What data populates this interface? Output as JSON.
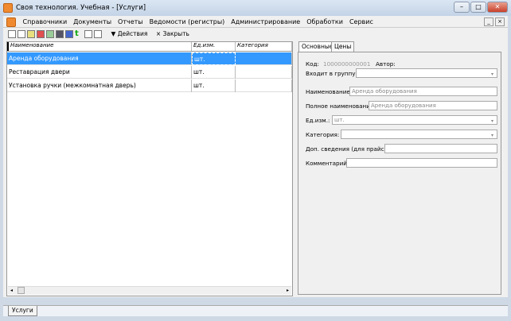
{
  "window": {
    "title": "Своя технология. Учебная - [Услуги]",
    "minimize": "–",
    "maximize": "□",
    "close": "✕"
  },
  "menu": [
    "Справочники",
    "Документы",
    "Отчеты",
    "Ведомости (регистры)",
    "Администрирование",
    "Обработки",
    "Сервис"
  ],
  "toolbar": {
    "actions_label": "▼ Действия",
    "close_label": "× Закрыть"
  },
  "table": {
    "columns": [
      "Наименование",
      "Ед.изм.",
      "Категория"
    ],
    "rows": [
      {
        "name": "Аренда оборудования",
        "unit": "шт.",
        "category": "",
        "selected": true
      },
      {
        "name": "Реставрация двери",
        "unit": "шт.",
        "category": ""
      },
      {
        "name": "Установка ручки (межкомнатная дверь)",
        "unit": "шт.",
        "category": ""
      }
    ]
  },
  "form": {
    "tabs": [
      "Основные",
      "Цены"
    ],
    "code_label": "Код:",
    "code_value": "1000000000001",
    "author_label": "Автор:",
    "group_label": "Входит в группу:",
    "group_value": "",
    "name_label": "Наименование:",
    "name_value": "Аренда оборудования",
    "fullname_label": "Полное наименование:",
    "fullname_value": "Аренда оборудования",
    "unit_label": "Ед.изм.:",
    "unit_value": "шт.",
    "category_label": "Категория:",
    "category_value": "",
    "extra_label": "Доп. сведения (для прайса):",
    "extra_value": "",
    "comment_label": "Комментарий:",
    "comment_value": ""
  },
  "bottom_tabs": [
    "Услуги"
  ]
}
